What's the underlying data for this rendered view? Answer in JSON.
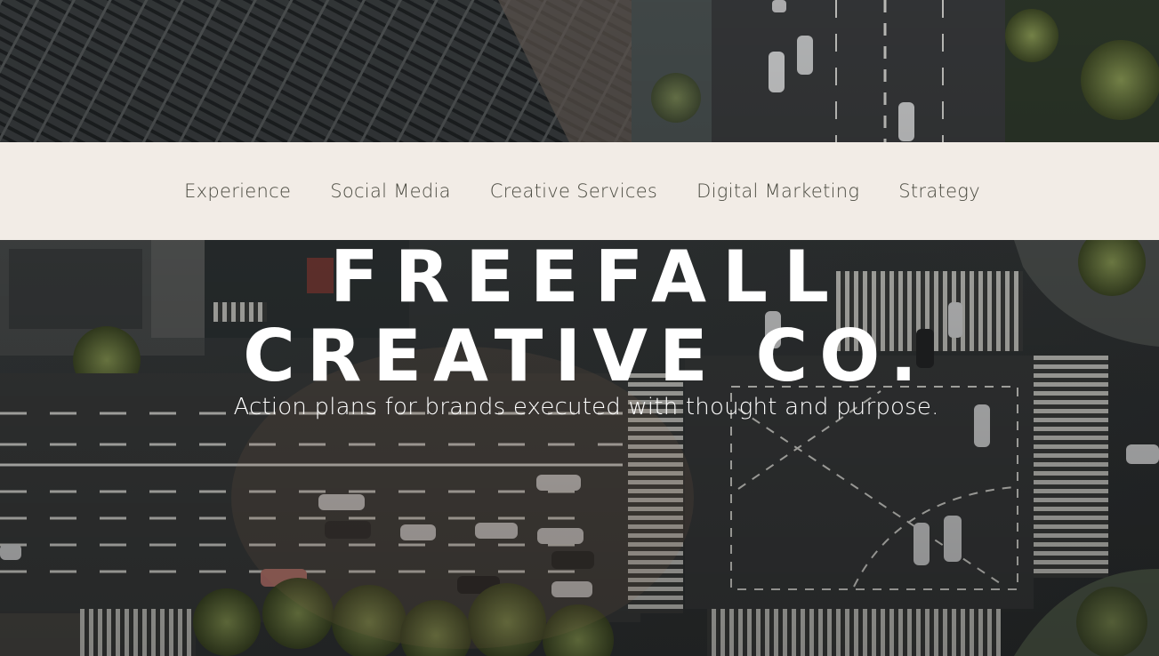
{
  "nav": {
    "items": [
      {
        "label": "Experience"
      },
      {
        "label": "Social Media"
      },
      {
        "label": "Creative Services"
      },
      {
        "label": "Digital Marketing"
      },
      {
        "label": "Strategy"
      }
    ]
  },
  "hero": {
    "title_line1": "FREEFALL",
    "title_line2": "CREATIVE CO.",
    "tagline": "Action plans for brands executed with thought and purpose.",
    "background_image": "aerial-city-intersection"
  },
  "colors": {
    "nav_background": "#f2ece6",
    "nav_text": "#4a4a40",
    "hero_text": "#ffffff"
  }
}
